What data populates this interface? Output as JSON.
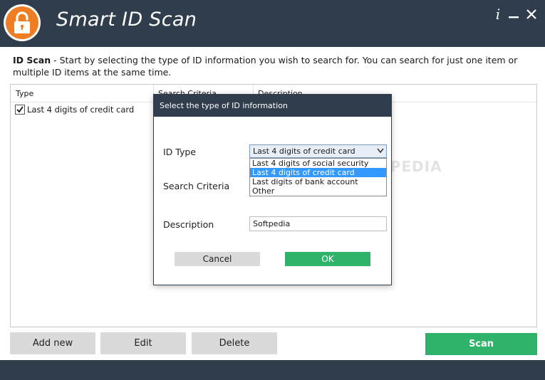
{
  "window": {
    "title": "Smart ID Scan",
    "info_label": "i",
    "logo_icon": "padlock-icon",
    "accent_color": "#ef7d23",
    "bar_color": "#2f3d4d"
  },
  "intro": {
    "heading": "ID Scan",
    "text": " - Start by selecting the type of ID information you wish to search for.  You can search for just one item or multiple ID items at the same time."
  },
  "table": {
    "columns": [
      "Type",
      "Search Criteria",
      "Description"
    ],
    "rows": [
      {
        "checked": true,
        "type": "Last 4 digits of credit card"
      }
    ]
  },
  "buttons": {
    "add_new": "Add new",
    "edit": "Edit",
    "delete": "Delete",
    "scan": "Scan"
  },
  "dialog": {
    "title": "Select the type of ID information",
    "id_type_label": "ID Type",
    "id_type_value": "Last 4 digits of credit card",
    "options": [
      "Last 4 digits of social security",
      "Last 4 digits of credit card",
      "Last digits of bank account",
      "Other"
    ],
    "selected_option_index": 1,
    "search_criteria_label": "Search Criteria",
    "description_label": "Description",
    "description_value": "Softpedia",
    "cancel_label": "Cancel",
    "ok_label": "OK"
  },
  "watermark": "SOFTPEDIA"
}
